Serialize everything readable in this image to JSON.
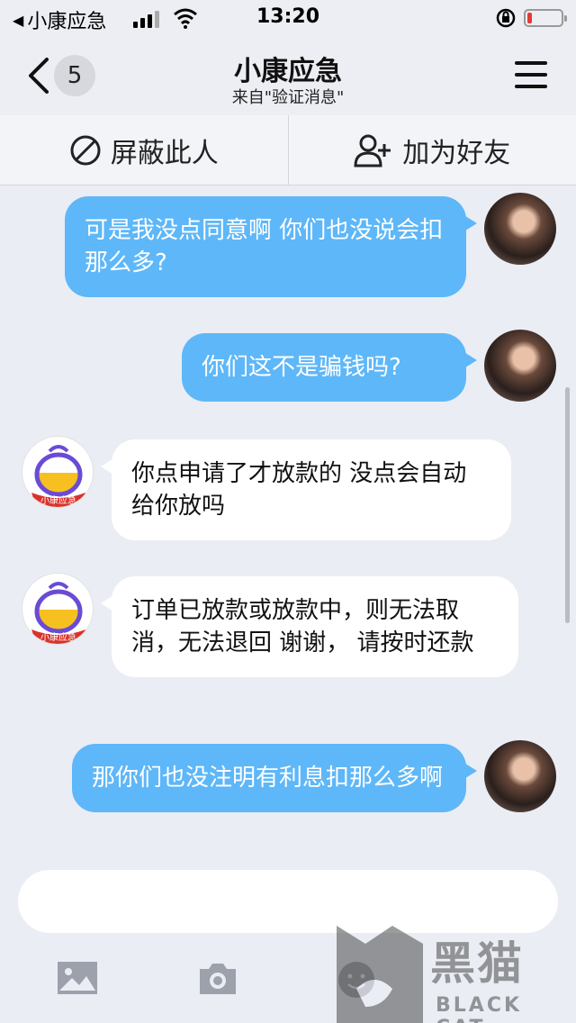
{
  "status_bar": {
    "back_app_label": "小康应急",
    "time": "13:20",
    "battery_level": 0.15
  },
  "nav": {
    "back_icon": "chevron-left-icon",
    "unread_count": "5",
    "title": "小康应急",
    "subtitle": "来自\"验证消息\"",
    "menu_icon": "menu-icon"
  },
  "actions": {
    "block_label": "屏蔽此人",
    "add_friend_label": "加为好友"
  },
  "messages": [
    {
      "from": "me",
      "text": "可是我没点同意啊 你们也没说会扣那么多?"
    },
    {
      "from": "me",
      "text": "你们这不是骗钱吗?"
    },
    {
      "from": "them",
      "text": "你点申请了才放款的 没点会自动 给你放吗"
    },
    {
      "from": "them",
      "text": "订单已放款或放款中，则无法取消，无法退回 谢谢， 请按时还款"
    },
    {
      "from": "me",
      "text": "那你们也没注明有利息扣那么多啊"
    }
  ],
  "bot_avatar_label": "小康应急",
  "input": {
    "value": "",
    "placeholder": ""
  },
  "toolbar": [
    "image-icon",
    "camera-icon",
    "emoji-icon"
  ],
  "watermark": {
    "text": "黑猫",
    "en": "BLACK CAT"
  },
  "colors": {
    "outgoing_bubble": "#5eb7f8",
    "incoming_bubble": "#ffffff",
    "background": "#eaedf4",
    "battery_low": "#e53935"
  }
}
